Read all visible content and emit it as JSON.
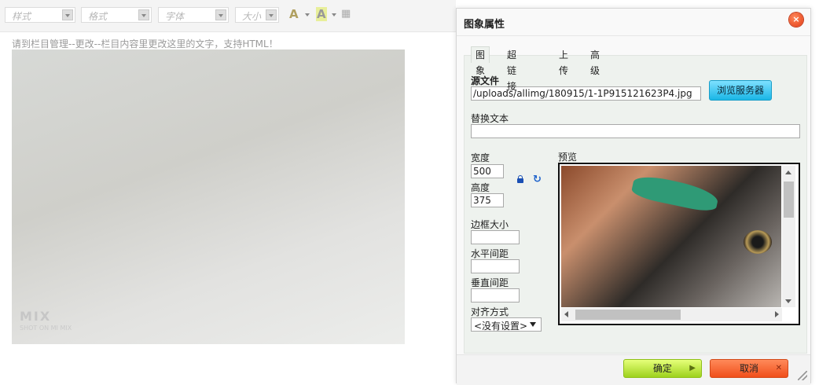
{
  "toolbar": {
    "style_label": "样式",
    "format_label": "格式",
    "font_label": "字体",
    "size_label": "大小",
    "text_color_glyph": "A",
    "bg_color_glyph": "A",
    "show_blocks_glyph": "▦"
  },
  "editor": {
    "hint_text": "请到栏目管理--更改--栏目内容里更改这里的文字，支持HTML！",
    "watermark_main": "MIX",
    "watermark_sub": "SHOT ON MI MIX"
  },
  "dialog": {
    "title": "图象属性",
    "close_glyph": "×",
    "tabs": [
      {
        "label": "图象",
        "active": true
      },
      {
        "label": "超链接",
        "active": false
      },
      {
        "label": "上传",
        "active": false
      },
      {
        "label": "高级",
        "active": false
      }
    ],
    "source_label": "源文件",
    "source_value": "/uploads/allimg/180915/1-1P915121623P4.jpg",
    "browse_label": "浏览服务器",
    "alt_label": "替换文本",
    "alt_value": "",
    "width_label": "宽度",
    "width_value": "500",
    "height_label": "高度",
    "height_value": "375",
    "border_label": "边框大小",
    "border_value": "",
    "hspace_label": "水平间距",
    "hspace_value": "",
    "vspace_label": "垂直间距",
    "vspace_value": "",
    "align_label": "对齐方式",
    "align_value": "<没有设置>",
    "preview_label": "预览",
    "ok_label": "确定",
    "cancel_label": "取消",
    "ok_glyph": "▶",
    "cancel_glyph": "✕",
    "refresh_glyph": "↻"
  },
  "icons": {
    "close": "close-icon",
    "lock": "lock-icon",
    "reset": "refresh-icon",
    "resize": "resize-grip-icon"
  },
  "colors": {
    "browse_button": "#1ab6e6",
    "ok_button": "#9ed21d",
    "cancel_button": "#f04e1a",
    "close_button": "#e23a13"
  }
}
